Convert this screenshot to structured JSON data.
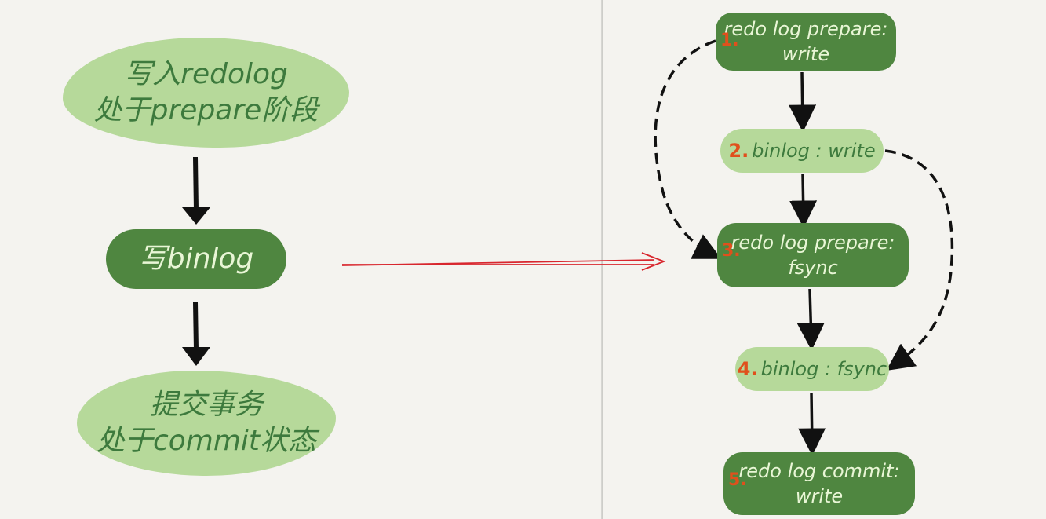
{
  "left_flow": {
    "step1": {
      "line1": "写入redolog",
      "line2": "处于prepare阶段"
    },
    "step2": {
      "line1": "写binlog"
    },
    "step3": {
      "line1": "提交事务",
      "line2": "处于commit状态"
    }
  },
  "right_flow": {
    "node1": {
      "number": "1.",
      "line1": "redo log prepare:",
      "line2": "write"
    },
    "node2": {
      "number": "2.",
      "line1": "binlog : write"
    },
    "node3": {
      "number": "3.",
      "line1": "redo log prepare:",
      "line2": "fsync"
    },
    "node4": {
      "number": "4.",
      "line1": "binlog : fsync"
    },
    "node5": {
      "number": "5.",
      "line1": "redo log commit:",
      "line2": "write"
    }
  },
  "colors": {
    "background": "#f4f3ef",
    "light_node": "#b6d99a",
    "dark_node": "#4f8640",
    "arrow": "#111111",
    "connector_arrow": "#d8262e",
    "step_number": "#e0501c"
  }
}
